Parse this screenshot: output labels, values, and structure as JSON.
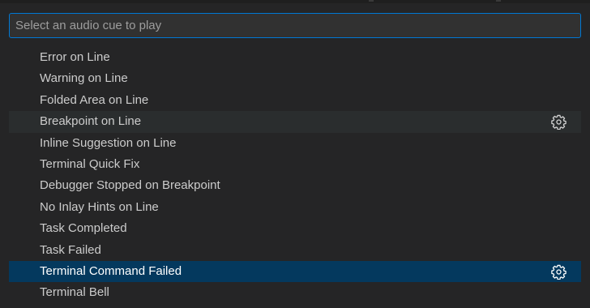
{
  "quick_pick": {
    "placeholder": "Select an audio cue to play",
    "value": "",
    "items": [
      {
        "label": "Error on Line",
        "state": "normal"
      },
      {
        "label": "Warning on Line",
        "state": "normal"
      },
      {
        "label": "Folded Area on Line",
        "state": "normal"
      },
      {
        "label": "Breakpoint on Line",
        "state": "hover",
        "action_icon": "gear-icon"
      },
      {
        "label": "Inline Suggestion on Line",
        "state": "normal"
      },
      {
        "label": "Terminal Quick Fix",
        "state": "normal"
      },
      {
        "label": "Debugger Stopped on Breakpoint",
        "state": "normal"
      },
      {
        "label": "No Inlay Hints on Line",
        "state": "normal"
      },
      {
        "label": "Task Completed",
        "state": "normal"
      },
      {
        "label": "Task Failed",
        "state": "normal"
      },
      {
        "label": "Terminal Command Failed",
        "state": "selected",
        "action_icon": "gear-icon"
      },
      {
        "label": "Terminal Bell",
        "state": "normal"
      }
    ]
  },
  "colors": {
    "focus_border": "#0078d4",
    "selected_background": "#04395e",
    "hover_background": "#2a2d2e",
    "widget_background": "#252526"
  }
}
